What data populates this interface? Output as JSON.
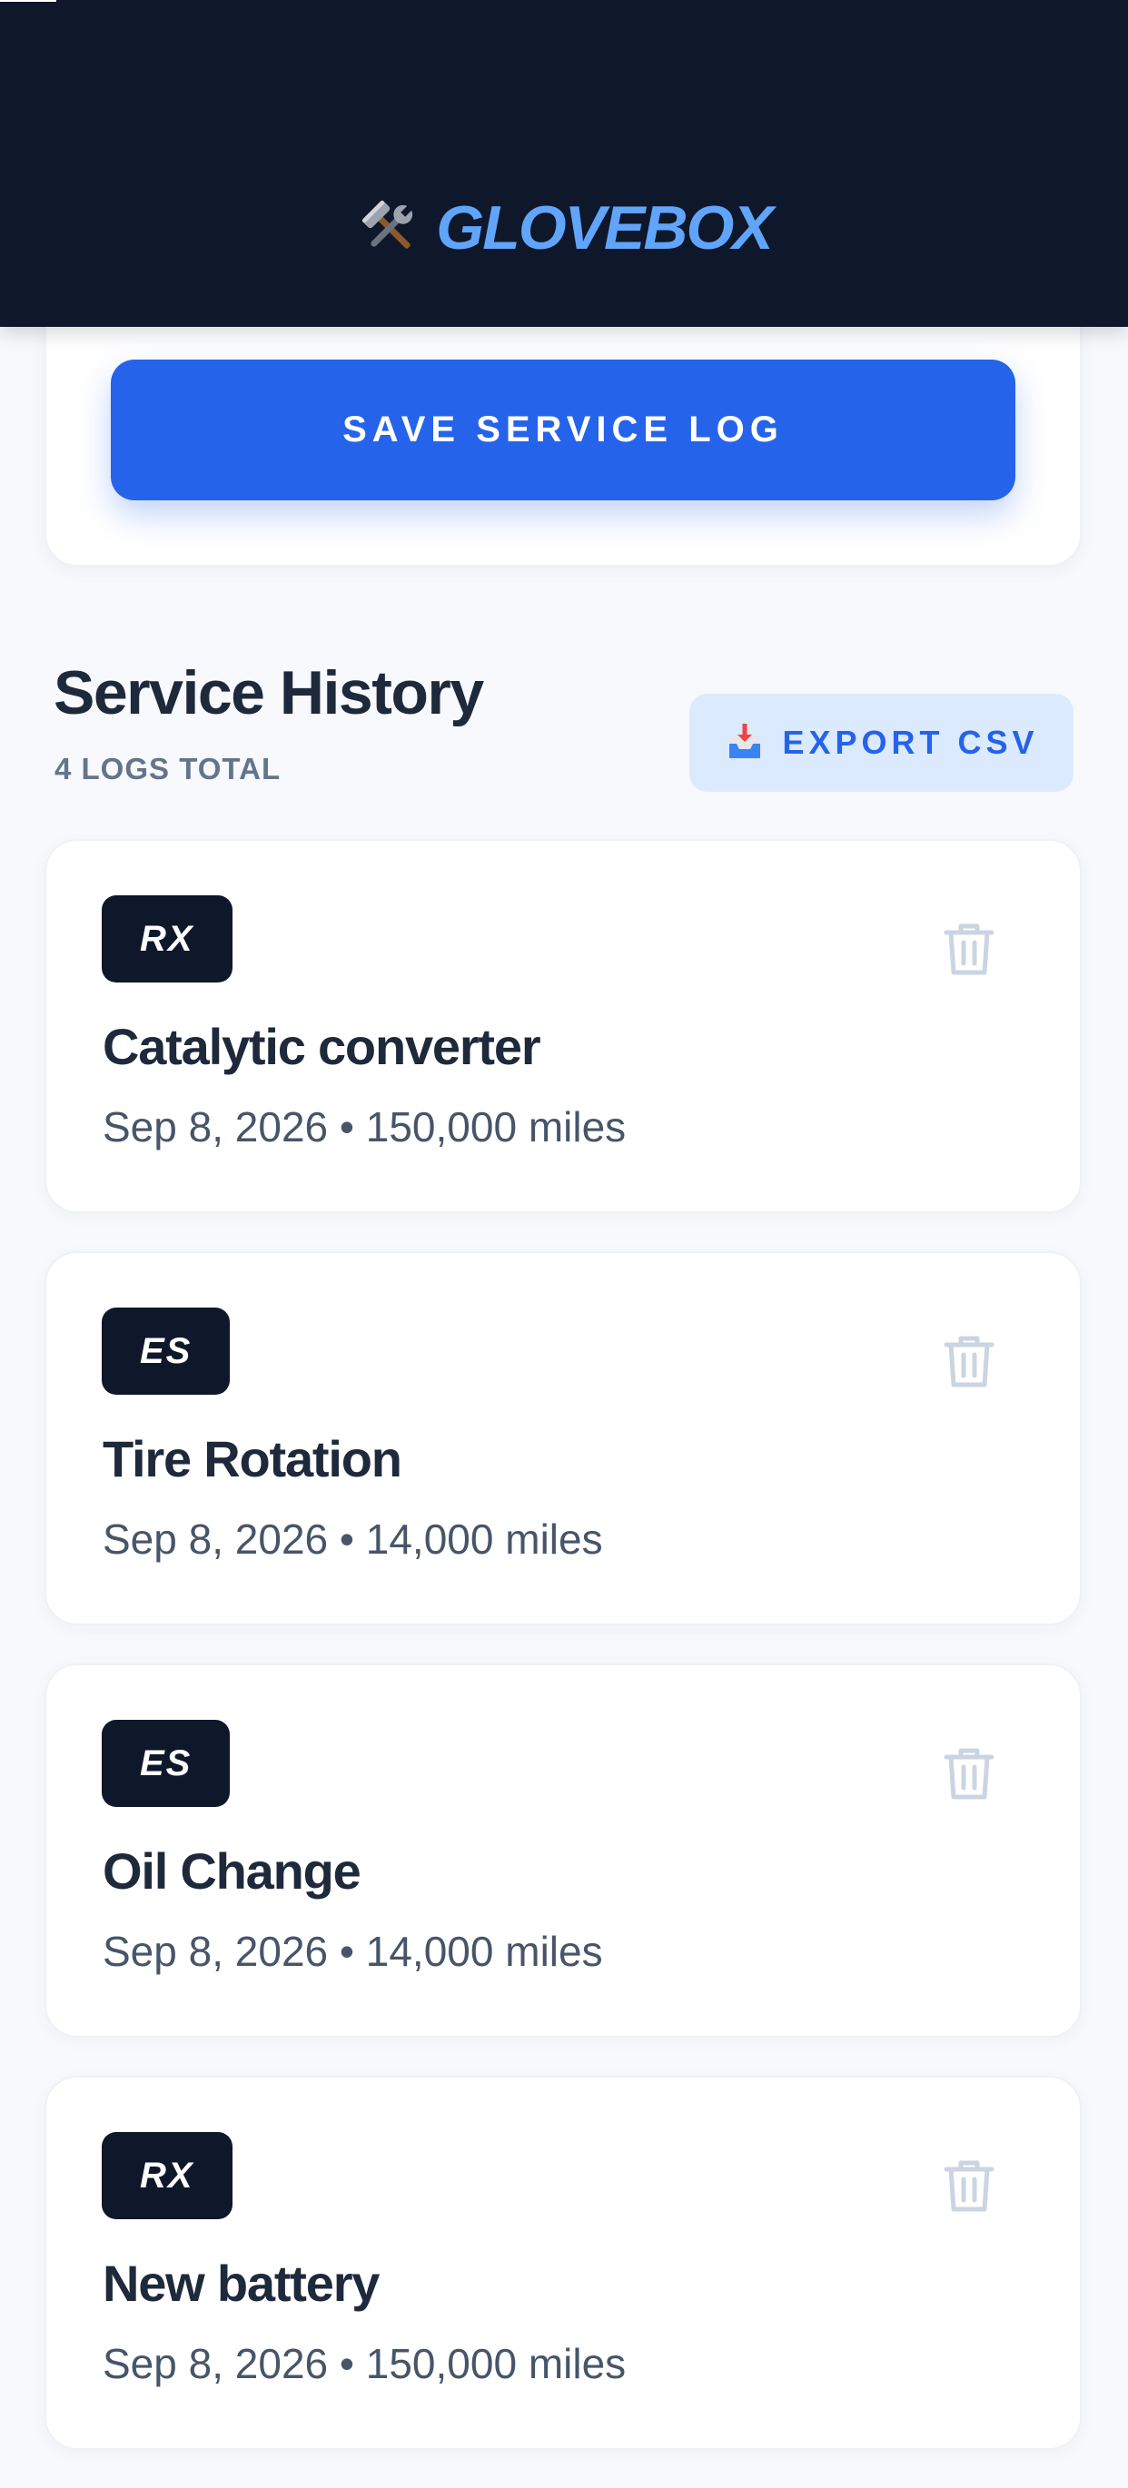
{
  "header": {
    "title": "GLOVEBOX",
    "icon": "tools-icon"
  },
  "form": {
    "save_label": "SAVE SERVICE LOG"
  },
  "history": {
    "title": "Service History",
    "count_label": "4 LOGS TOTAL",
    "export_label": "EXPORT CSV",
    "export_icon": "inbox-tray-icon"
  },
  "logs": [
    {
      "badge": "RX",
      "service": "Catalytic converter",
      "meta": "Sep 8, 2026 • 150,000 miles"
    },
    {
      "badge": "ES",
      "service": "Tire Rotation",
      "meta": "Sep 8, 2026 • 14,000 miles"
    },
    {
      "badge": "ES",
      "service": "Oil Change",
      "meta": "Sep 8, 2026 • 14,000 miles"
    },
    {
      "badge": "RX",
      "service": "New battery",
      "meta": "Sep 8, 2026 • 150,000 miles"
    }
  ],
  "colors": {
    "header_bg": "#0f172a",
    "brand": "#60a5fa",
    "primary": "#2563eb",
    "export_bg": "#dbeafe",
    "badge_bg": "#0f172a",
    "trash": "#cbd5e1"
  }
}
